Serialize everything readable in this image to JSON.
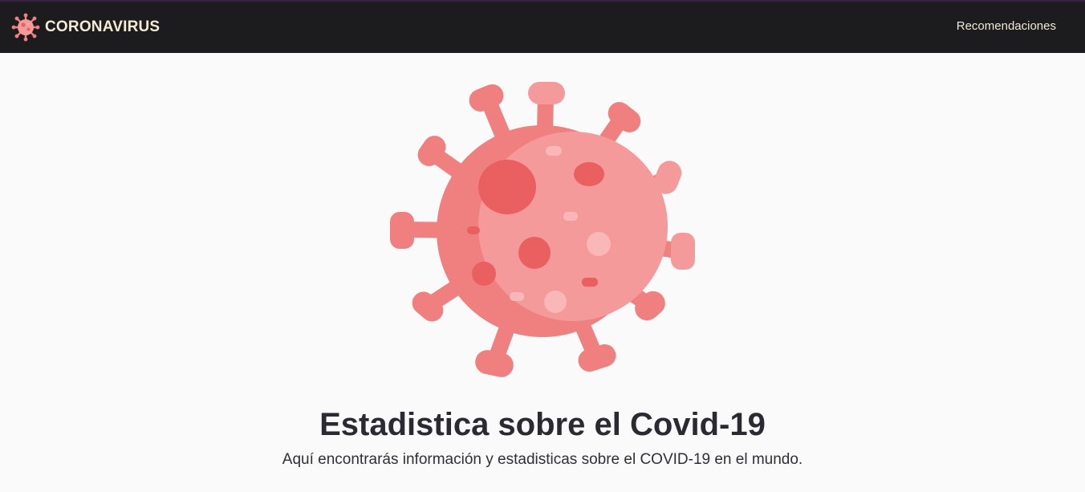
{
  "header": {
    "brand_label": "CORONAVIRUS",
    "logo_icon": "virus-icon",
    "nav_link_label": "Recomendaciones"
  },
  "hero": {
    "illustration_icon": "virus-illustration",
    "title": "Estadistica sobre el Covid-19",
    "subtitle": "Aquí encontrarás información y estadisticas sobre el COVID-19 en el mundo."
  },
  "colors": {
    "header_bg": "#1c1c1e",
    "brand_text": "#f4ead6",
    "virus_dark": "#f08080",
    "virus_light": "#f59a9a",
    "virus_spot": "#ea6060",
    "page_bg": "#fafafa",
    "title_text": "#2b2a33"
  }
}
